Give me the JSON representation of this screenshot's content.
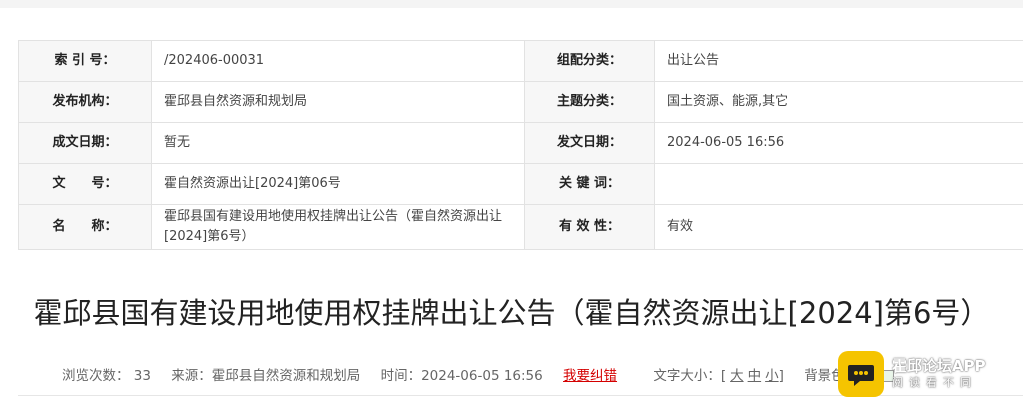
{
  "meta_table": {
    "rows": [
      {
        "label1": "索 引 号：",
        "value1": "/202406-00031",
        "label2": "组配分类：",
        "value2": "出让公告"
      },
      {
        "label1": "发布机构：",
        "value1": "霍邱县自然资源和规划局",
        "label2": "主题分类：",
        "value2": "国土资源、能源,其它"
      },
      {
        "label1": "成文日期：",
        "value1": "暂无",
        "label2": "发文日期：",
        "value2": "2024-06-05 16:56"
      },
      {
        "label1": "文　　号：",
        "value1": "霍自然资源出让[2024]第06号",
        "label2": "关 键 词：",
        "value2": ""
      },
      {
        "label1": "名　　称：",
        "value1": "霍邱县国有建设用地使用权挂牌出让公告（霍自然资源出让[2024]第6号）",
        "label2": "有 效 性：",
        "value2": "有效"
      }
    ]
  },
  "article": {
    "title": "霍邱县国有建设用地使用权挂牌出让公告（霍自然资源出让[2024]第6号）"
  },
  "info_bar": {
    "views_label": "浏览次数：",
    "views": "33",
    "source_label": "来源：",
    "source": "霍邱县自然资源和规划局",
    "time_label": "时间：",
    "time": "2024-06-05 16:56",
    "error_link": "我要纠错",
    "font_size_label": "文字大小：[",
    "font_large": "大",
    "font_medium": "中",
    "font_small": "小",
    "font_close": "]",
    "bg_label": "背景色"
  },
  "watermark": {
    "title": "霍邱论坛APP",
    "subtitle": "阅读看不同"
  },
  "colors": {
    "label_bg": "#f7f7f7",
    "border": "#e2e2e2",
    "error_link": "#d40000",
    "watermark_icon": "#f5c400"
  }
}
